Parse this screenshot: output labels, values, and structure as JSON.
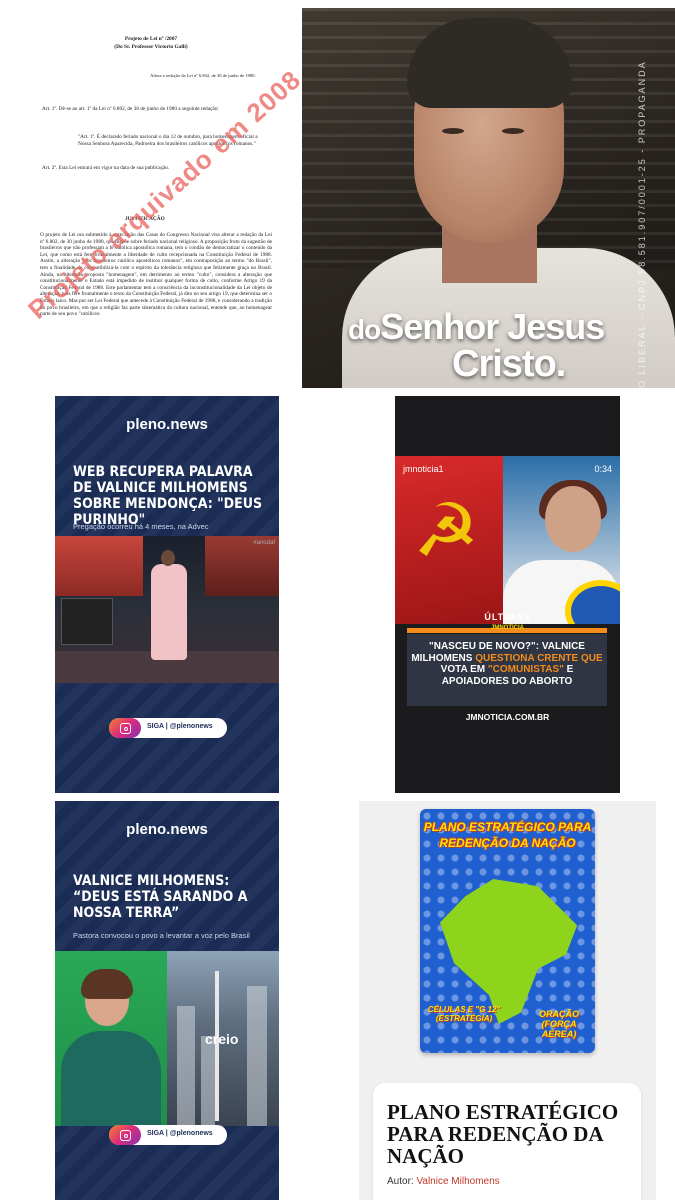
{
  "document": {
    "header_line1": "Projeto de Lei nº        /2007",
    "header_line2": "(Do Sr. Professor Victorio Galli)",
    "ementa": "Altera a redação da Lei nº 6.802, de 30 de junho de 1980.",
    "art1": "Art. 1º. Dê-se ao art. 1º da Lei nº 6.802, de 30 de junho de 1980 a seguinte redação:",
    "quote": "\"Art. 1º. É declarado feriado nacional o dia 12 de outubro, para homenagem oficial a Nossa Senhora Aparecida, Padroeira dos brasileiros católicos apostólicos romanos.\"",
    "art2": "Art. 2º. Esta Lei entrará em vigor na data de sua publicação.",
    "justificacao_heading": "JUSTIFICAÇÃO",
    "justificacao_text": "O projeto de Lei ora submetido à apreciação das Casas do Congresso Nacional visa alterar a redação da Lei nº 6.802, de 30 junho de 1980, que dispõe sobre feriado nacional religioso. A proposição fruto da sugestão de brasileiros que não professam a fé católica apostólica romana, tem o condão de democratizar o conteúdo da Lei, que como está fere frontalmente a liberdade de culto recepcionada na Constituição Federal de 1988. Assim, a alteração \"dos brasileiros católico apostólicos romanos\", em contraposição ao termo \"do Brasil\", tem a finalidade de compatibilizá-la com o espírito da tolerância religiosa que felizmente graça no Brasil. Ainda, na alteração proposta \"homenagem\", em detrimento ao termo \"culto\", considera a alteração que constitucionalmente o Estado está impedido de instituir qualquer forma de culto, conforme Artigo 19 da Constituição Federal de 1988. Este parlamentar tem a consciência da inconstitucionalidade da Lei objeto de alteração, pois fere frontalmente o texto da Constituição Federal, já dito no seu artigo 19, que determina ser o Estado laico. Mas por ser Lei Federal que antecede à Constituição Federal de 1988, e considerando a tradição do povo brasileiro, em que a religião faz parte sistemática da cultura nacional, entende que, ao homenagear parte de seu povo \"católicos",
    "stamp": "Projeto arquivado em 2008"
  },
  "video1": {
    "vertical_text": "O LIBERAL - CNPJ 58.581.907/0001-25 - PROPAGANDA",
    "caption_line1_small": "do",
    "caption_line1": "Senhor Jesus",
    "caption_line2": "Cristo."
  },
  "pleno1": {
    "logo_main": "pleno",
    "logo_dot": ".",
    "logo_end": "news",
    "headline": "WEB RECUPERA PALAVRA DE VALNICE MILHOMENS SOBRE MENDONÇA: \"DEUS PURINHO\"",
    "subtitle": "Pregação ocorreu há 4 meses, na Advec",
    "photo_tag": "#anodaf",
    "follow": "SIGA | @plenonews"
  },
  "jmnoticia": {
    "username": "jmnoticia1",
    "duration": "0:34",
    "section": "ÚLTIMAS",
    "brand": "JMNOTÍCIA",
    "title_part1": "\"NASCEU DE NOVO?\": VALNICE MILHOMENS ",
    "title_highlight1": "QUESTIONA CRENTE QUE",
    "title_part2": " VOTA EM ",
    "title_highlight2": "\"COMUNISTAS\"",
    "title_part3": " E APOIADORES DO ABORTO",
    "site": "JMNOTICIA.COM.BR"
  },
  "pleno2": {
    "logo_main": "pleno",
    "logo_dot": ".",
    "logo_end": "news",
    "headline": "VALNICE MILHOMENS: “DEUS ESTÁ SARANDO A NOSSA TERRA”",
    "subtitle": "Pastora convocou o povo a levantar a voz pelo Brasil",
    "photo_text": "creio",
    "follow": "SIGA | @plenonews"
  },
  "book": {
    "cover_title": "PLANO ESTRATÉGICO PARA REDENÇÃO DA NAÇÃO",
    "cover_label_left": "CÉLULAS E \"G 12\" (ESTRATÉGIA)",
    "cover_label_right": "ORAÇÃO (FORÇA AÉREA)",
    "title": "PLANO ESTRATÉGICO PARA REDENÇÃO DA NAÇÃO",
    "author_label": "Autor: ",
    "author_name": "Valnice Milhomens"
  }
}
